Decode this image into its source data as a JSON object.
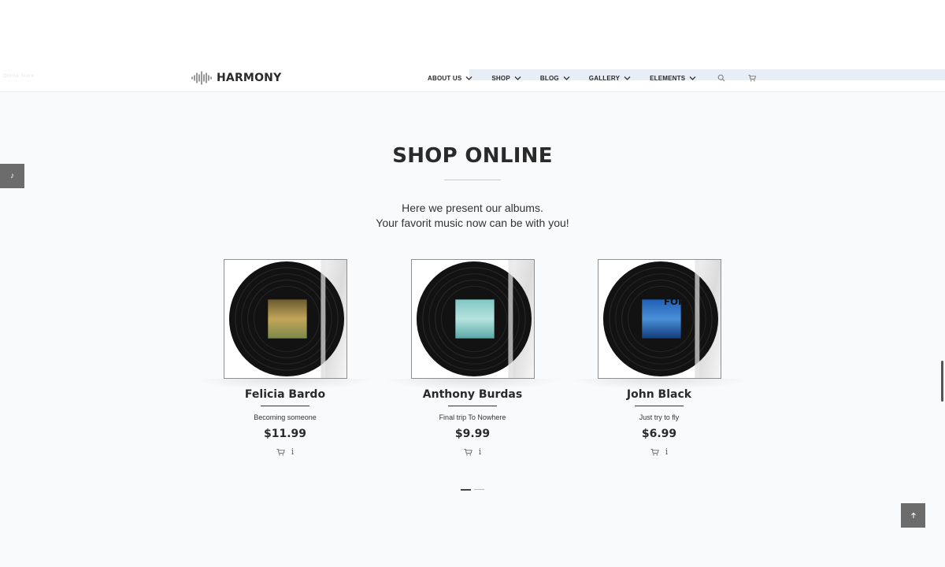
{
  "header": {
    "faint_text": "Online Store",
    "logo_text": "HARMONY",
    "nav": [
      {
        "label": "ABOUT US"
      },
      {
        "label": "SHOP"
      },
      {
        "label": "BLOG"
      },
      {
        "label": "GALLERY"
      },
      {
        "label": "ELEMENTS"
      }
    ],
    "search_icon": "search-icon",
    "cart_icon": "cart-icon"
  },
  "sidebar": {
    "icon": "music-note-icon",
    "glyph": "♪"
  },
  "section": {
    "title": "SHOP ONLINE",
    "subtitle_line1": "Here we present our albums.",
    "subtitle_line2": "Your favorit music now can be with you!"
  },
  "products": [
    {
      "artist": "Felicia Bardo",
      "album": "Becoming someone",
      "price": "$11.99",
      "cover_colors": [
        "#6b5a2e",
        "#c2a55a",
        "#7b8a4a"
      ]
    },
    {
      "artist": "Anthony Burdas",
      "album": "Final trip To Nowhere",
      "price": "$9.99",
      "cover_colors": [
        "#7fc7c4",
        "#b6e3df",
        "#5aa9a8"
      ]
    },
    {
      "artist": "John Black",
      "album": "Just try to fly",
      "price": "$6.99",
      "cover_colors": [
        "#1f5fb4",
        "#4b8fd8",
        "#123c7a"
      ],
      "cover_text": "FOR"
    }
  ],
  "pager": {
    "pages": 2,
    "active": 1
  },
  "back_to_top_icon": "arrow-up-icon",
  "colors": {
    "accent_dark": "#2a2a2a",
    "button_gray": "#6c6c6c",
    "background": "#f9fafb"
  }
}
